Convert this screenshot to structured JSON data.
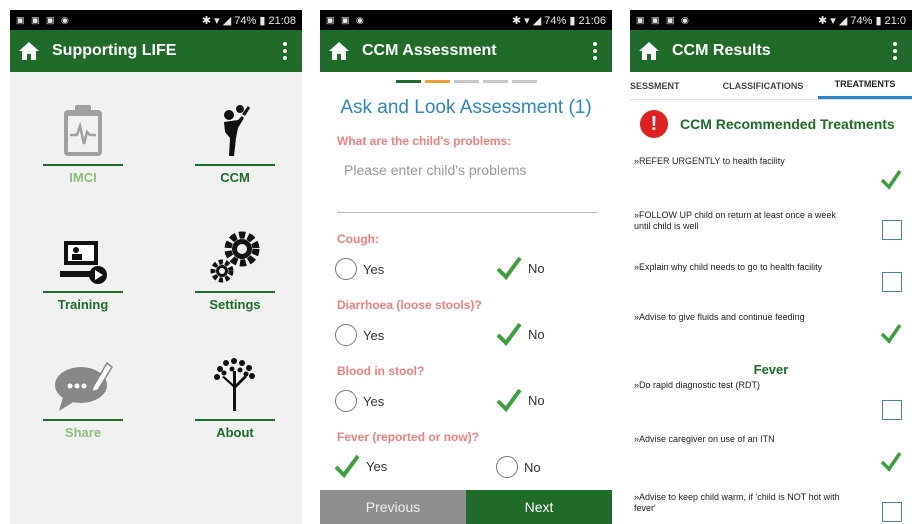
{
  "phone1": {
    "status_time": "21:08",
    "status_battery": "74%",
    "title": "Supporting LIFE",
    "tiles": [
      {
        "label": "IMCI",
        "icon": "clipboard-heartbeat-icon"
      },
      {
        "label": "CCM",
        "icon": "adult-lifting-child-icon"
      },
      {
        "label": "Training",
        "icon": "presentation-laptop-icon"
      },
      {
        "label": "Settings",
        "icon": "gears-icon"
      },
      {
        "label": "Share",
        "icon": "speech-bubble-pencil-icon"
      },
      {
        "label": "About",
        "icon": "tree-icon"
      }
    ]
  },
  "phone2": {
    "status_time": "21:06",
    "status_battery": "74%",
    "title": "CCM Assessment",
    "heading": "Ask and Look Assessment (1)",
    "problems_label": "What are the child's problems:",
    "problems_placeholder": "Please enter child's problems",
    "questions": [
      {
        "label": "Cough:",
        "yes": "Yes",
        "no": "No",
        "selected": "No"
      },
      {
        "label": "Diarrhoea (loose stools)?",
        "yes": "Yes",
        "no": "No",
        "selected": "No"
      },
      {
        "label": "Blood in stool?",
        "yes": "Yes",
        "no": "No",
        "selected": "No"
      },
      {
        "label": "Fever (reported or now)?",
        "yes": "Yes",
        "no": "No",
        "selected": "Yes"
      }
    ],
    "prev_label": "Previous",
    "next_label": "Next"
  },
  "phone3": {
    "status_time": "21:0",
    "status_battery": "74%",
    "title": "CCM Results",
    "tabs": [
      "SESSMENT",
      "CLASSIFICATIONS",
      "TREATMENTS"
    ],
    "heading": "CCM Recommended Treatments",
    "items": [
      {
        "text": "»REFER URGENTLY to health facility",
        "checked": true
      },
      {
        "text": "»FOLLOW UP child on return at least once a week until child is well",
        "checked": false
      },
      {
        "text": "»Explain why child needs to go to health facility",
        "checked": false
      },
      {
        "text": "»Advise to give fluids and continue feeding",
        "checked": true
      }
    ],
    "section": "Fever",
    "fever_items": [
      {
        "text": "»Do rapid diagnostic test (RDT)",
        "checked": false
      },
      {
        "text": "»Advise caregiver on use of an ITN",
        "checked": true
      },
      {
        "text": "»Advise to keep child warm, if 'child is NOT hot with fever'",
        "checked": false
      }
    ]
  },
  "colors": {
    "primary": "#1f6b2a",
    "accent": "#2e86c1",
    "question": "#f08080",
    "alert": "#e02020"
  }
}
